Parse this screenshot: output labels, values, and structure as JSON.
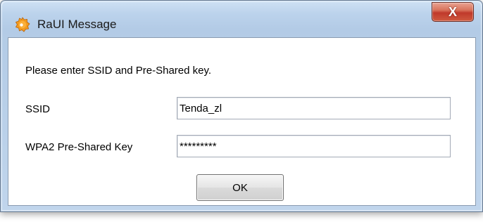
{
  "window": {
    "title": "RaUI Message",
    "close_label": "X"
  },
  "dialog": {
    "prompt": "Please enter SSID and Pre-Shared key.",
    "ssid_label": "SSID",
    "ssid_value": "Tenda_zl",
    "key_label": "WPA2 Pre-Shared Key",
    "key_value": "*********",
    "ok_label": "OK"
  },
  "colors": {
    "titlebar": "#bcd3ec",
    "close_button": "#c0392b",
    "dialog_background": "#ffffff"
  },
  "icons": {
    "app": "raui-app-icon",
    "close": "close-icon"
  }
}
